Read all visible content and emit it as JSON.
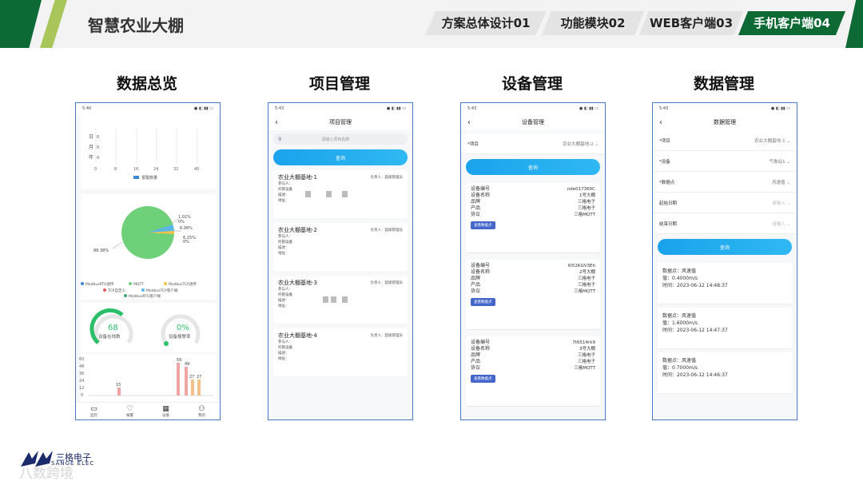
{
  "header": {
    "title": "智慧农业大棚",
    "tabs": [
      "方案总体设计01",
      "功能模块02",
      "WEB客户端03",
      "手机客户端04"
    ],
    "active_tab": 3
  },
  "sections": [
    "数据总览",
    "项目管理",
    "设备管理",
    "数据管理"
  ],
  "status_times": [
    "5:40",
    "5:43",
    "5:43",
    "5:43"
  ],
  "overview": {
    "bar_rows": [
      "日",
      "月",
      "年"
    ],
    "bar_row_values": [
      "0",
      "0",
      "0"
    ],
    "bar_x_ticks": [
      "0",
      "8",
      "16",
      "24",
      "32",
      "40"
    ],
    "bar_legend": "报警数量",
    "pie_labels": [
      "1.01%",
      "0%",
      "6.06%",
      "6.25%",
      "0%",
      "88.38%"
    ],
    "legend": [
      "ModbusRTU透传",
      "MQTT",
      "ModbusTCP透传",
      "TCP自定义",
      "ModbusTCP客户端",
      "ModbusRTU客户端"
    ],
    "gauge1_value": "68",
    "gauge1_label": "设备在线数",
    "gauge2_value": "0%",
    "gauge2_label": "设备报警率",
    "col_y_ticks": [
      "60",
      "48",
      "36",
      "24",
      "12",
      "0"
    ],
    "col_labels": [
      "56",
      "49",
      "15",
      "27",
      "27"
    ],
    "tabbar": [
      "监控",
      "报警",
      "设备",
      "我的"
    ]
  },
  "project": {
    "nav_title": "项目管理",
    "search_placeholder": "请输入项目名称",
    "query": "查询",
    "items": [
      {
        "name": "农业大棚基地-1",
        "owner": "负责人：超级管理员",
        "f1": "参与人：",
        "f2": "托管设备",
        "f3": "描述：",
        "f4": "地址："
      },
      {
        "name": "农业大棚基地-2",
        "owner": "负责人：超级管理员",
        "f1": "参与人：",
        "f2": "托管设备",
        "f3": "描述：",
        "f4": "地址："
      },
      {
        "name": "农业大棚基地-3",
        "owner": "负责人：超级管理员",
        "f1": "参与人：",
        "f2": "托管设备",
        "f3": "描述：",
        "f4": "地址："
      },
      {
        "name": "农业大棚基地-4",
        "owner": "负责人：超级管理员",
        "f1": "参与人：",
        "f2": "托管设备",
        "f3": "描述：",
        "f4": "地址："
      }
    ]
  },
  "device": {
    "nav_title": "设备管理",
    "project_label": "*项目",
    "project_value": "农业大棚基地-2",
    "query": "查询",
    "field_labels": [
      "设备编号",
      "设备名称",
      "品牌",
      "产品",
      "协议"
    ],
    "detail_btn": "查看数据点",
    "items": [
      {
        "vals": [
          "nde017360C",
          "1号大棚",
          "三格电子",
          "三格电子",
          "三格MQTT"
        ]
      },
      {
        "vals": [
          "6l52KGV3Eh",
          "2号大棚",
          "三格电子",
          "三格电子",
          "三格MQTT"
        ]
      },
      {
        "vals": [
          "7t6514rk9",
          "3号大棚",
          "三格电子",
          "三格电子",
          "三格MQTT"
        ]
      }
    ]
  },
  "datamgmt": {
    "nav_title": "数据管理",
    "fields": [
      {
        "label": "*项目",
        "value": "农业大棚基地-1"
      },
      {
        "label": "*设备",
        "value": "气象站1"
      },
      {
        "label": "*数据点",
        "value": "风速值"
      },
      {
        "label": "起始日期",
        "value": "请输入"
      },
      {
        "label": "结束日期",
        "value": "请输入"
      }
    ],
    "query": "查询",
    "records": [
      {
        "l1": "数据点：风速值",
        "l2": "值：0.4000m/s",
        "l3": "时间：2023-06-12 14:48:37"
      },
      {
        "l1": "数据点：风速值",
        "l2": "值：1.6000m/s",
        "l3": "时间：2023-06-12 14:47:37"
      },
      {
        "l1": "数据点：风速值",
        "l2": "值：0.7000m/s",
        "l3": "时间：2023-06-12 14:46:37"
      }
    ]
  },
  "footer": {
    "logo_cn": "三格电子",
    "logo_en": "SANGE ELEC",
    "watermark": "八数跨境"
  }
}
